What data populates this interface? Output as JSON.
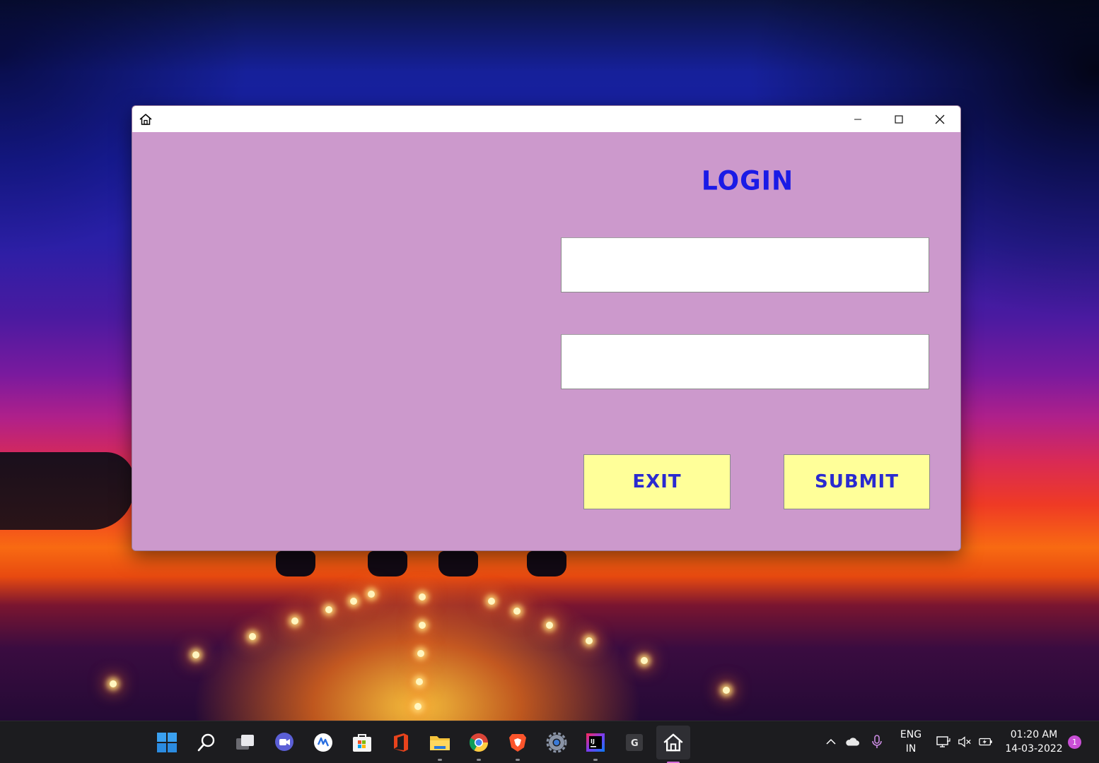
{
  "window": {
    "title": "",
    "login_title": "LOGIN",
    "username_value": "",
    "password_value": "",
    "exit_label": "EXIT",
    "submit_label": "SUBMIT",
    "colors": {
      "background": "#cc99cc",
      "title_text": "#1a1ae6",
      "button_bg": "#ffff99",
      "button_text": "#2a2ad0"
    }
  },
  "taskbar": {
    "icons": [
      {
        "name": "start-icon"
      },
      {
        "name": "search-icon"
      },
      {
        "name": "task-view-icon"
      },
      {
        "name": "chat-icon"
      },
      {
        "name": "widgets-icon"
      },
      {
        "name": "store-icon"
      },
      {
        "name": "office-icon"
      },
      {
        "name": "file-explorer-icon"
      },
      {
        "name": "chrome-icon"
      },
      {
        "name": "brave-icon"
      },
      {
        "name": "settings-icon"
      },
      {
        "name": "intellij-icon"
      },
      {
        "name": "g-app-icon"
      },
      {
        "name": "home-app-icon"
      }
    ],
    "language_line1": "ENG",
    "language_line2": "IN",
    "time": "01:20 AM",
    "date": "14-03-2022",
    "notification_count": "1"
  }
}
